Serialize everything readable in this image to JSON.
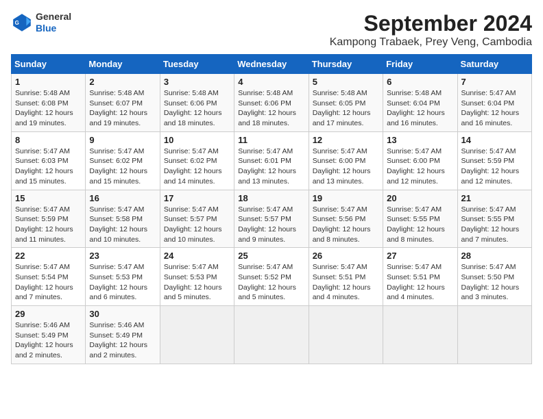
{
  "header": {
    "logo_line1": "General",
    "logo_line2": "Blue",
    "month": "September 2024",
    "location": "Kampong Trabaek, Prey Veng, Cambodia"
  },
  "columns": [
    "Sunday",
    "Monday",
    "Tuesday",
    "Wednesday",
    "Thursday",
    "Friday",
    "Saturday"
  ],
  "weeks": [
    [
      {
        "day": "1",
        "info": "Sunrise: 5:48 AM\nSunset: 6:08 PM\nDaylight: 12 hours\nand 19 minutes."
      },
      {
        "day": "2",
        "info": "Sunrise: 5:48 AM\nSunset: 6:07 PM\nDaylight: 12 hours\nand 19 minutes."
      },
      {
        "day": "3",
        "info": "Sunrise: 5:48 AM\nSunset: 6:06 PM\nDaylight: 12 hours\nand 18 minutes."
      },
      {
        "day": "4",
        "info": "Sunrise: 5:48 AM\nSunset: 6:06 PM\nDaylight: 12 hours\nand 18 minutes."
      },
      {
        "day": "5",
        "info": "Sunrise: 5:48 AM\nSunset: 6:05 PM\nDaylight: 12 hours\nand 17 minutes."
      },
      {
        "day": "6",
        "info": "Sunrise: 5:48 AM\nSunset: 6:04 PM\nDaylight: 12 hours\nand 16 minutes."
      },
      {
        "day": "7",
        "info": "Sunrise: 5:47 AM\nSunset: 6:04 PM\nDaylight: 12 hours\nand 16 minutes."
      }
    ],
    [
      {
        "day": "8",
        "info": "Sunrise: 5:47 AM\nSunset: 6:03 PM\nDaylight: 12 hours\nand 15 minutes."
      },
      {
        "day": "9",
        "info": "Sunrise: 5:47 AM\nSunset: 6:02 PM\nDaylight: 12 hours\nand 15 minutes."
      },
      {
        "day": "10",
        "info": "Sunrise: 5:47 AM\nSunset: 6:02 PM\nDaylight: 12 hours\nand 14 minutes."
      },
      {
        "day": "11",
        "info": "Sunrise: 5:47 AM\nSunset: 6:01 PM\nDaylight: 12 hours\nand 13 minutes."
      },
      {
        "day": "12",
        "info": "Sunrise: 5:47 AM\nSunset: 6:00 PM\nDaylight: 12 hours\nand 13 minutes."
      },
      {
        "day": "13",
        "info": "Sunrise: 5:47 AM\nSunset: 6:00 PM\nDaylight: 12 hours\nand 12 minutes."
      },
      {
        "day": "14",
        "info": "Sunrise: 5:47 AM\nSunset: 5:59 PM\nDaylight: 12 hours\nand 12 minutes."
      }
    ],
    [
      {
        "day": "15",
        "info": "Sunrise: 5:47 AM\nSunset: 5:59 PM\nDaylight: 12 hours\nand 11 minutes."
      },
      {
        "day": "16",
        "info": "Sunrise: 5:47 AM\nSunset: 5:58 PM\nDaylight: 12 hours\nand 10 minutes."
      },
      {
        "day": "17",
        "info": "Sunrise: 5:47 AM\nSunset: 5:57 PM\nDaylight: 12 hours\nand 10 minutes."
      },
      {
        "day": "18",
        "info": "Sunrise: 5:47 AM\nSunset: 5:57 PM\nDaylight: 12 hours\nand 9 minutes."
      },
      {
        "day": "19",
        "info": "Sunrise: 5:47 AM\nSunset: 5:56 PM\nDaylight: 12 hours\nand 8 minutes."
      },
      {
        "day": "20",
        "info": "Sunrise: 5:47 AM\nSunset: 5:55 PM\nDaylight: 12 hours\nand 8 minutes."
      },
      {
        "day": "21",
        "info": "Sunrise: 5:47 AM\nSunset: 5:55 PM\nDaylight: 12 hours\nand 7 minutes."
      }
    ],
    [
      {
        "day": "22",
        "info": "Sunrise: 5:47 AM\nSunset: 5:54 PM\nDaylight: 12 hours\nand 7 minutes."
      },
      {
        "day": "23",
        "info": "Sunrise: 5:47 AM\nSunset: 5:53 PM\nDaylight: 12 hours\nand 6 minutes."
      },
      {
        "day": "24",
        "info": "Sunrise: 5:47 AM\nSunset: 5:53 PM\nDaylight: 12 hours\nand 5 minutes."
      },
      {
        "day": "25",
        "info": "Sunrise: 5:47 AM\nSunset: 5:52 PM\nDaylight: 12 hours\nand 5 minutes."
      },
      {
        "day": "26",
        "info": "Sunrise: 5:47 AM\nSunset: 5:51 PM\nDaylight: 12 hours\nand 4 minutes."
      },
      {
        "day": "27",
        "info": "Sunrise: 5:47 AM\nSunset: 5:51 PM\nDaylight: 12 hours\nand 4 minutes."
      },
      {
        "day": "28",
        "info": "Sunrise: 5:47 AM\nSunset: 5:50 PM\nDaylight: 12 hours\nand 3 minutes."
      }
    ],
    [
      {
        "day": "29",
        "info": "Sunrise: 5:46 AM\nSunset: 5:49 PM\nDaylight: 12 hours\nand 2 minutes."
      },
      {
        "day": "30",
        "info": "Sunrise: 5:46 AM\nSunset: 5:49 PM\nDaylight: 12 hours\nand 2 minutes."
      },
      {
        "day": "",
        "info": ""
      },
      {
        "day": "",
        "info": ""
      },
      {
        "day": "",
        "info": ""
      },
      {
        "day": "",
        "info": ""
      },
      {
        "day": "",
        "info": ""
      }
    ]
  ]
}
